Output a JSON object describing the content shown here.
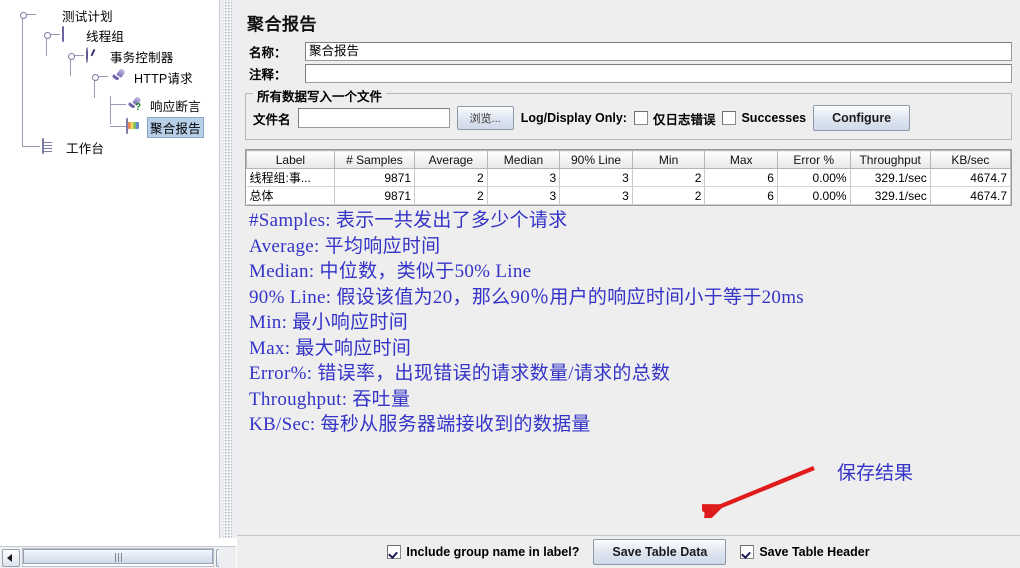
{
  "tree": {
    "items": [
      {
        "label": "测试计划",
        "icon": "flask-icon",
        "selected": false
      },
      {
        "label": "线程组",
        "icon": "thread-group-icon",
        "selected": false
      },
      {
        "label": "事务控制器",
        "icon": "transaction-controller-icon",
        "selected": false
      },
      {
        "label": "HTTP请求",
        "icon": "http-request-icon",
        "selected": false
      },
      {
        "label": "响应断言",
        "icon": "response-assertion-icon",
        "selected": false
      },
      {
        "label": "聚合报告",
        "icon": "aggregate-report-icon",
        "selected": true
      },
      {
        "label": "工作台",
        "icon": "workbench-icon",
        "selected": false
      }
    ]
  },
  "panel": {
    "title": "聚合报告",
    "name_label": "名称：",
    "name_value": "聚合报告",
    "comment_label": "注释：",
    "comment_value": "",
    "comment_placeholder": ""
  },
  "file_group": {
    "title": "所有数据写入一个文件",
    "filename_label": "文件名",
    "filename_value": "",
    "browse_label": "浏览...",
    "logdisplay_label": "Log/Display Only:",
    "errors_only_label": "仅日志错误",
    "errors_only_checked": false,
    "successes_label": "Successes",
    "successes_checked": false,
    "configure_label": "Configure"
  },
  "table": {
    "columns": [
      "Label",
      "# Samples",
      "Average",
      "Median",
      "90% Line",
      "Min",
      "Max",
      "Error %",
      "Throughput",
      "KB/sec"
    ],
    "rows": [
      [
        "线程组:事...",
        "9871",
        "2",
        "3",
        "3",
        "2",
        "6",
        "0.00%",
        "329.1/sec",
        "4674.7"
      ],
      [
        "总体",
        "9871",
        "2",
        "3",
        "3",
        "2",
        "6",
        "0.00%",
        "329.1/sec",
        "4674.7"
      ]
    ]
  },
  "annotations": {
    "color": "#3434c8",
    "lines": [
      "#Samples:  表示一共发出了多少个请求",
      "Average:  平均响应时间",
      "Median:  中位数，类似于50% Line",
      "90% Line:  假设该值为20，那么90％用户的响应时间小于等于20ms",
      "Min:  最小响应时间",
      "Max:  最大响应时间",
      "Error%:  错误率，出现错误的请求数量/请求的总数",
      "Throughput:  吞吐量",
      "KB/Sec:  每秒从服务器端接收到的数据量"
    ],
    "callout_text": "保存结果",
    "callout_arrow_color": "#e01b1b"
  },
  "bottom_bar": {
    "include_group_label": "Include group name in label?",
    "include_group_checked": true,
    "save_table_data_label": "Save Table Data",
    "save_table_header_label": "Save Table Header",
    "save_table_header_checked": true
  }
}
